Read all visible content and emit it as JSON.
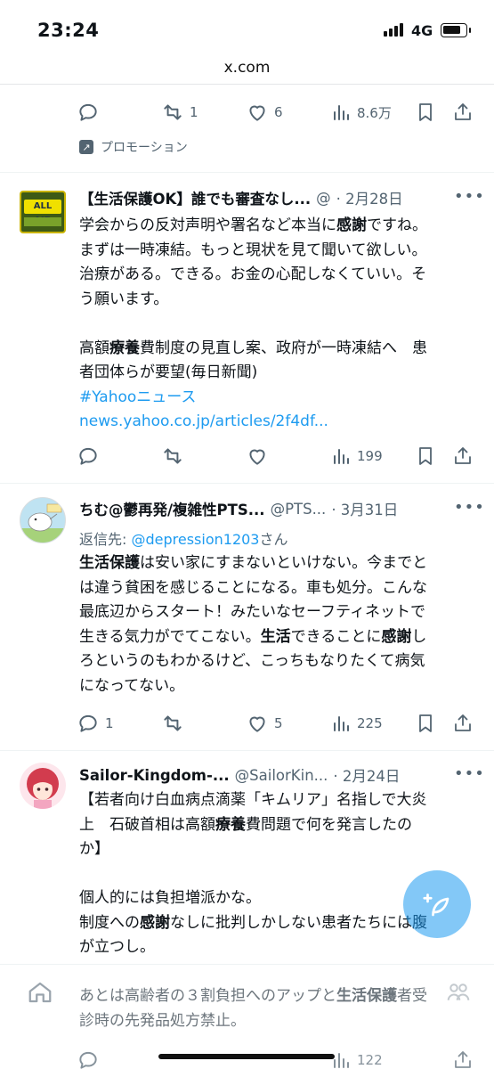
{
  "status": {
    "time": "23:24",
    "network": "4G"
  },
  "browser": {
    "url": "x.com"
  },
  "tweet0": {
    "retweets": "1",
    "likes": "6",
    "views": "8.6万",
    "promotion_label": "プロモーション"
  },
  "tweet1": {
    "name": "【生活保護OK】誰でも審査なし...",
    "handle": "@",
    "date": "· 2月28日",
    "avatar_text": "ALL AID",
    "lines": [
      "学会からの反対声明や署名など本当に",
      "感謝",
      "ですね。",
      "まずは一時凍結。もっと現状を見て聞いて欲しい。",
      "治療がある。できる。お金の心配しなくていい。そ",
      "う願います。",
      "高額",
      "療養",
      "費制度の見直し案、政府が一時凍結へ　患",
      "者団体らが要望(毎日新聞)"
    ],
    "hashtag": "#Yahooニュース",
    "link": "news.yahoo.co.jp/articles/2f4df...",
    "views": "199"
  },
  "tweet2": {
    "name": "ちむ@鬱再発/複雑性PTS...",
    "handle": "@PTS...",
    "date": "· 3月31日",
    "reply_prefix": "返信先: ",
    "reply_to": "@depression1203",
    "reply_suffix": "さん",
    "t": [
      "生活保護",
      "は安い家にすまないといけない。今までと",
      "は違う貧困を感じることになる。車も処分。こんな",
      "最底辺からスタート！みたいなセーフティネットで",
      "生きる気力がでてこない。",
      "生活",
      "できることに",
      "感謝",
      "し",
      "ろというのもわかるけど、こっちもなりたくて病気",
      "になってない。"
    ],
    "replies": "1",
    "likes": "5",
    "views": "225"
  },
  "tweet3": {
    "name": "Sailor-Kingdom-...",
    "handle": "@SailorKin...",
    "date": "· 2月24日",
    "t": [
      "【若者向け白血病点滴薬「キムリア」名指しで大炎",
      "上　石破首相は高額",
      "療養",
      "費問題で何を発言したの",
      "か】",
      "個人的には負担増派かな。",
      "制度への",
      "感謝",
      "なしに批判しかしない患者たちには腹",
      "が立つし。",
      "あとは高齢者の３割負担へのアップと",
      "生活保護",
      "者受",
      "診時の先発品処方禁止。"
    ],
    "views": "122"
  },
  "colors": {
    "accent": "#1d9bf0",
    "muted": "#536471",
    "text": "#0f1419"
  }
}
